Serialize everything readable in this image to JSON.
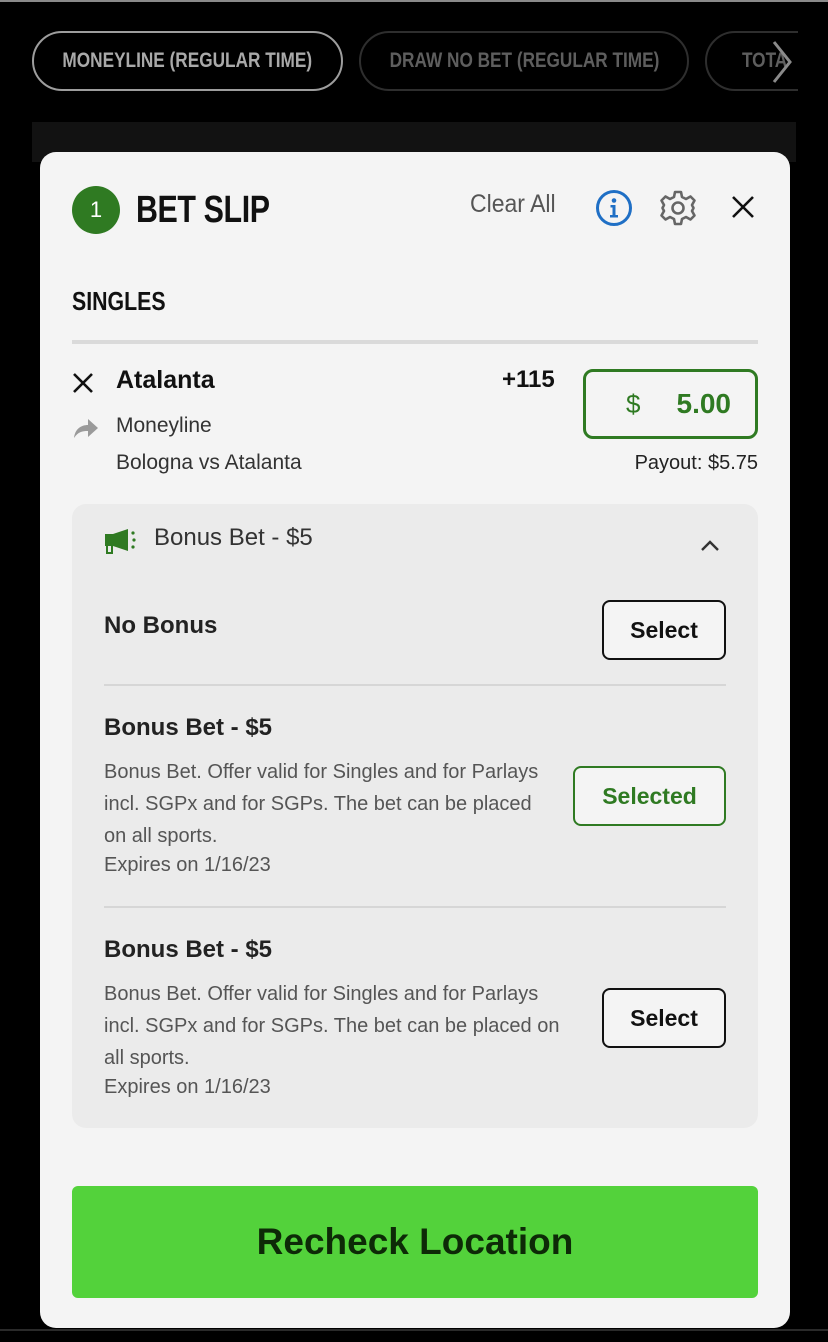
{
  "market_tabs": [
    {
      "label": "MONEYLINE (REGULAR TIME)",
      "active": true
    },
    {
      "label": "DRAW NO BET (REGULAR TIME)",
      "active": false
    },
    {
      "label": "TOTA",
      "active": false
    }
  ],
  "bet_slip": {
    "count": "1",
    "title": "BET SLIP",
    "clear_all": "Clear All",
    "section": "SINGLES",
    "bet": {
      "selection": "Atalanta",
      "odds": "+115",
      "market": "Moneyline",
      "matchup": "Bologna vs Atalanta",
      "currency": "$",
      "stake": "5.00",
      "payout": "Payout: $5.75"
    },
    "bonus": {
      "header": "Bonus Bet - $5",
      "options": [
        {
          "title": "No Bonus",
          "button": "Select",
          "selected": false
        },
        {
          "title": "Bonus Bet - $5",
          "description": "Bonus Bet. Offer valid for Singles and for Parlays incl. SGPx and for SGPs. The bet can be placed on all sports.",
          "expires": "Expires on 1/16/23",
          "button": "Selected",
          "selected": true
        },
        {
          "title": "Bonus Bet - $5",
          "description": "Bonus Bet. Offer valid for Singles and for Parlays incl. SGPx and for SGPs. The bet can be placed on all sports.",
          "expires": "Expires on 1/16/23",
          "button": "Select",
          "selected": false
        }
      ]
    },
    "primary_action": "Recheck Location"
  },
  "colors": {
    "brand_green": "#2f7a22",
    "action_green": "#53d23b",
    "info_blue": "#1f6fc5"
  },
  "icons": {
    "info": "info-icon",
    "settings": "gear-icon",
    "close": "close-icon",
    "remove": "remove-x-icon",
    "market": "share-arrow-icon",
    "bonus": "megaphone-icon",
    "collapse": "chevron-up-icon",
    "scroll": "chevron-right-icon"
  }
}
